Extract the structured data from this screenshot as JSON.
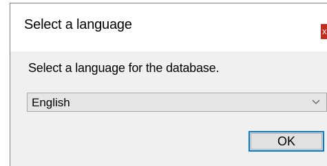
{
  "dialog": {
    "title": "Select a language",
    "close_label": "x",
    "prompt": "Select a language for the database.",
    "language_select": {
      "selected": "English"
    },
    "ok_label": "OK"
  },
  "icons": {
    "chevron": "chevron-down-icon"
  },
  "colors": {
    "close_button": "#c42b1c",
    "ok_border": "#0078d7",
    "body_background": "#f0f0f0"
  }
}
